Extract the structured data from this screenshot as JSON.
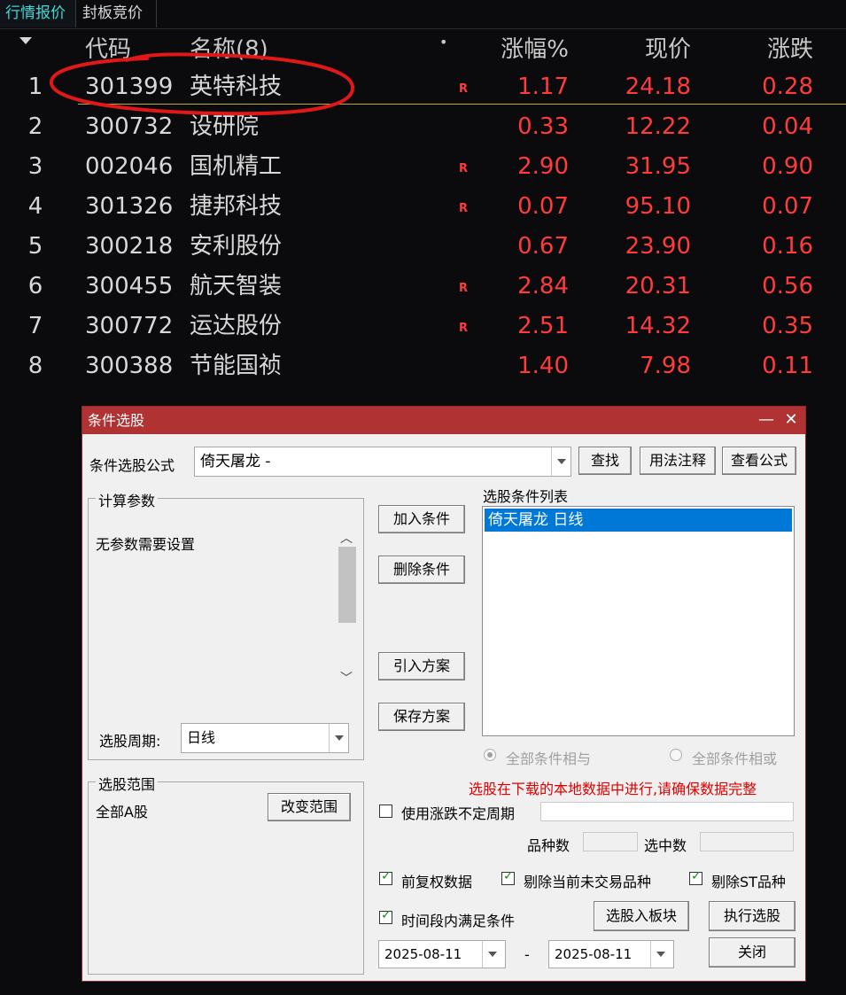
{
  "tabs": [
    {
      "label": "行情报价",
      "active": true
    },
    {
      "label": "封板竞价",
      "active": false
    }
  ],
  "table": {
    "headers": {
      "code": "代码",
      "name": "名称(8)",
      "dot": "•",
      "pct": "涨幅%",
      "price": "现价",
      "change": "涨跌"
    },
    "rows": [
      {
        "idx": "1",
        "code": "301399",
        "name": "英特科技",
        "r": "R",
        "pct": "1.17",
        "price": "24.18",
        "change": "0.28"
      },
      {
        "idx": "2",
        "code": "300732",
        "name": "设研院",
        "r": "",
        "pct": "0.33",
        "price": "12.22",
        "change": "0.04"
      },
      {
        "idx": "3",
        "code": "002046",
        "name": "国机精工",
        "r": "R",
        "pct": "2.90",
        "price": "31.95",
        "change": "0.90"
      },
      {
        "idx": "4",
        "code": "301326",
        "name": "捷邦科技",
        "r": "R",
        "pct": "0.07",
        "price": "95.10",
        "change": "0.07"
      },
      {
        "idx": "5",
        "code": "300218",
        "name": "安利股份",
        "r": "",
        "pct": "0.67",
        "price": "23.90",
        "change": "0.16"
      },
      {
        "idx": "6",
        "code": "300455",
        "name": "航天智装",
        "r": "R",
        "pct": "2.84",
        "price": "20.31",
        "change": "0.56"
      },
      {
        "idx": "7",
        "code": "300772",
        "name": "运达股份",
        "r": "R",
        "pct": "2.51",
        "price": "14.32",
        "change": "0.35"
      },
      {
        "idx": "8",
        "code": "300388",
        "name": "节能国祯",
        "r": "",
        "pct": "1.40",
        "price": "7.98",
        "change": "0.11"
      }
    ]
  },
  "dialog": {
    "title": "条件选股",
    "formula_label": "条件选股公式",
    "formula_value": "倚天屠龙  -",
    "find_btn": "查找",
    "usage_btn": "用法注释",
    "view_btn": "查看公式",
    "params_group": "计算参数",
    "params_text": "无参数需要设置",
    "period_label": "选股周期:",
    "period_value": "日线",
    "add_btn": "加入条件",
    "delete_btn": "删除条件",
    "import_btn": "引入方案",
    "save_btn": "保存方案",
    "cond_list_label": "选股条件列表",
    "cond_items": [
      "倚天屠龙  日线"
    ],
    "radio_and": "全部条件相与",
    "radio_or": "全部条件相或",
    "warning": "选股在下载的本地数据中进行,请确保数据完整",
    "range_group": "选股范围",
    "range_value": "全部A股",
    "change_range_btn": "改变范围",
    "var_period_label": "使用涨跌不定周期",
    "count_label": "品种数",
    "selected_label": "选中数",
    "cb_fq": "前复权数据",
    "cb_remove_untraded": "剔除当前未交易品种",
    "cb_remove_st": "剔除ST品种",
    "cb_time_range": "时间段内满足条件",
    "to_block_btn": "选股入板块",
    "execute_btn": "执行选股",
    "close_btn": "关闭",
    "date_from": "2025-08-11",
    "date_sep": "-",
    "date_to": "2025-08-11",
    "title_min": "—",
    "title_close": "✕"
  },
  "colors": {
    "red": "#ff3b3b",
    "accent": "#3fd7d7",
    "titlebar": "#b03232",
    "selection": "#0078d7"
  }
}
